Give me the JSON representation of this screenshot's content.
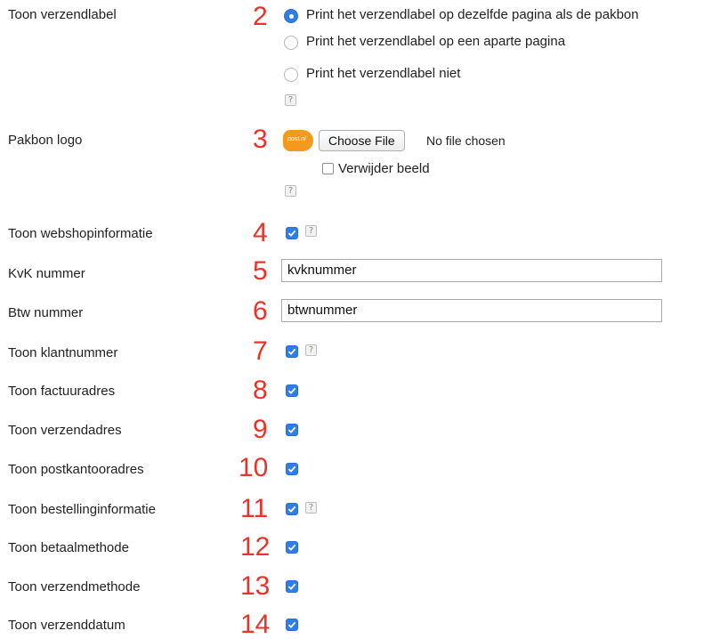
{
  "rows": [
    {
      "label": "Toon verzendlabel",
      "num": "2"
    },
    {
      "label": "Pakbon logo",
      "num": "3"
    },
    {
      "label": "Toon webshopinformatie",
      "num": "4"
    },
    {
      "label": "KvK nummer",
      "num": "5"
    },
    {
      "label": "Btw nummer",
      "num": "6"
    },
    {
      "label": "Toon klantnummer",
      "num": "7"
    },
    {
      "label": "Toon factuuradres",
      "num": "8"
    },
    {
      "label": "Toon verzendadres",
      "num": "9"
    },
    {
      "label": "Toon postkantooradres",
      "num": "10"
    },
    {
      "label": "Toon bestellinginformatie",
      "num": "11"
    },
    {
      "label": "Toon betaalmethode",
      "num": "12"
    },
    {
      "label": "Toon verzendmethode",
      "num": "13"
    },
    {
      "label": "Toon verzenddatum",
      "num": "14"
    }
  ],
  "label_options": [
    "Print het verzendlabel op dezelfde pagina als de pakbon",
    "Print het verzendlabel op een aparte pagina",
    "Print het verzendlabel niet"
  ],
  "help_glyph": "?",
  "logo_text": "post.nl",
  "file": {
    "button": "Choose File",
    "status": "No file chosen"
  },
  "remove_image": "Verwijder beeld",
  "kvk_value": "kvknummer",
  "btw_value": "btwnummer",
  "checkbox_states": {
    "selected_radio": 0
  }
}
